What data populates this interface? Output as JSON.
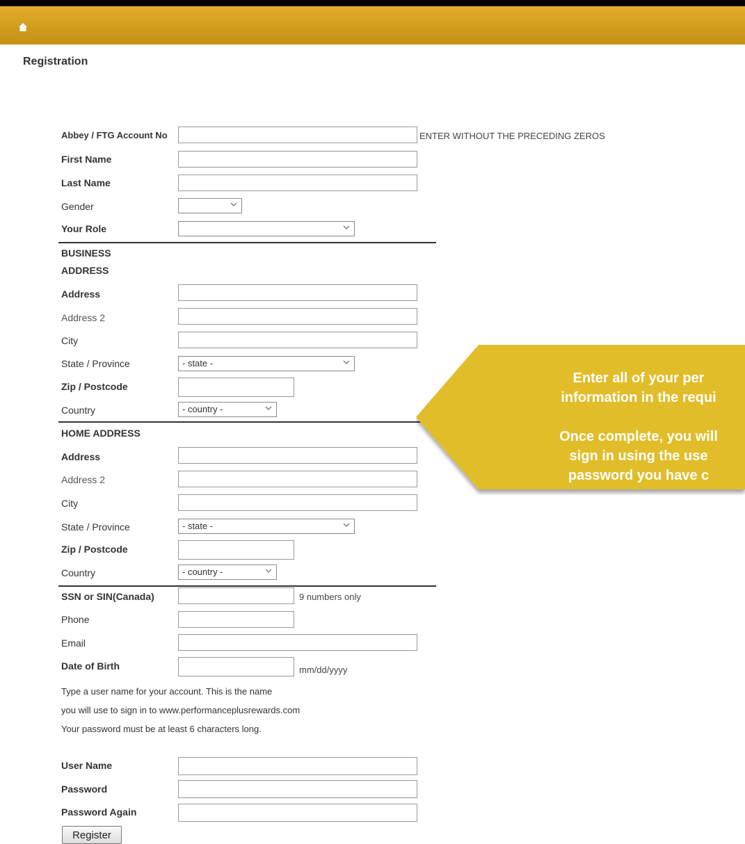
{
  "page": {
    "title": "Registration"
  },
  "colors": {
    "header_gold": "#d9a31f",
    "callout_gold": "#e2bd2a",
    "callout_text": "#ffffff"
  },
  "form": {
    "account_no": {
      "label": "Abbey / FTG Account No",
      "hint": "ENTER WITHOUT THE PRECEDING ZEROS",
      "value": ""
    },
    "first_name": {
      "label": "First Name",
      "value": ""
    },
    "last_name": {
      "label": "Last Name",
      "value": ""
    },
    "gender": {
      "label": "Gender",
      "selected": ""
    },
    "role": {
      "label": "Your Role",
      "selected": ""
    },
    "business_heading_line1": "BUSINESS",
    "business_heading_line2": "ADDRESS",
    "business": {
      "address": {
        "label": "Address",
        "value": ""
      },
      "address2": {
        "label": "Address 2",
        "value": ""
      },
      "city": {
        "label": "City",
        "value": ""
      },
      "state": {
        "label": "State / Province",
        "selected": "- state -"
      },
      "zip": {
        "label": "Zip / Postcode",
        "value": ""
      },
      "country": {
        "label": "Country",
        "selected": "- country -"
      }
    },
    "home_heading": "HOME ADDRESS",
    "home": {
      "address": {
        "label": "Address",
        "value": ""
      },
      "address2": {
        "label": "Address 2",
        "value": ""
      },
      "city": {
        "label": "City",
        "value": ""
      },
      "state": {
        "label": "State / Province",
        "selected": "- state -"
      },
      "zip": {
        "label": "Zip / Postcode",
        "value": ""
      },
      "country": {
        "label": "Country",
        "selected": "- country -"
      }
    },
    "ssn": {
      "label": "SSN or SIN(Canada)",
      "hint": "9 numbers only",
      "value": ""
    },
    "phone": {
      "label": "Phone",
      "value": ""
    },
    "email": {
      "label": "Email",
      "value": ""
    },
    "dob": {
      "label": "Date of Birth",
      "hint": "mm/dd/yyyy",
      "value": ""
    },
    "instructions": [
      "Type a user name for your account. This is the name",
      "you will use to sign in to www.performanceplusrewards.com",
      "Your password must be at least 6 characters long."
    ],
    "username": {
      "label": "User Name",
      "value": ""
    },
    "password": {
      "label": "Password",
      "value": ""
    },
    "password_again": {
      "label": "Password Again",
      "value": ""
    },
    "register_label": "Register"
  },
  "callout": {
    "lines": [
      "Enter all of your per",
      "information in the requi",
      "",
      "Once complete, you will",
      "sign in using the use",
      "password you have c"
    ]
  }
}
